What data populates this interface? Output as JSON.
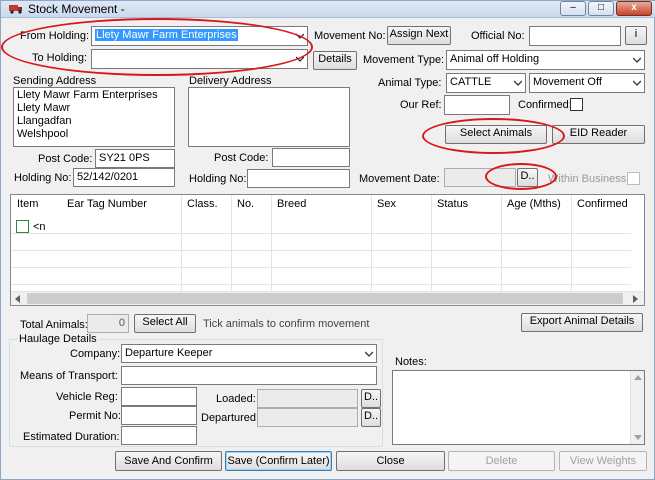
{
  "window": {
    "title": "Stock Movement -",
    "minimize": "–",
    "maximize": "□",
    "close": "x"
  },
  "holdings": {
    "from_label": "From Holding:",
    "from_value": "Llety Mawr Farm Enterprises",
    "to_label": "To Holding:",
    "to_value": "",
    "details_button": "Details"
  },
  "movement": {
    "number_label": "Movement No:",
    "assign_next_button": "Assign Next",
    "official_label": "Official No:",
    "official_value": "",
    "official_button": "i",
    "type_label": "Movement Type:",
    "type_value": "Animal off Holding",
    "animal_type_label": "Animal Type:",
    "animal_type_value": "CATTLE",
    "direction_value": "Movement Off",
    "our_ref_label": "Our Ref:",
    "our_ref_value": "",
    "confirmed_label": "Confirmed:",
    "select_animals_button": "Select Animals",
    "eid_reader_button": "EID Reader",
    "date_label": "Movement Date:",
    "date_value": "",
    "date_button": "D..",
    "within_business_label": "Within Business"
  },
  "sending": {
    "address_label": "Sending Address",
    "address_lines": [
      "Llety Mawr Farm Enterprises",
      "Llety Mawr",
      "Llangadfan",
      "Welshpool"
    ],
    "postcode_label": "Post Code:",
    "postcode_value": "SY21 0PS",
    "holding_no_label": "Holding No:",
    "holding_no_value": "52/142/0201"
  },
  "delivery": {
    "address_label": "Delivery Address",
    "postcode_label": "Post Code:",
    "postcode_value": "",
    "holding_no_label": "Holding No:",
    "holding_no_value": ""
  },
  "grid": {
    "columns": [
      "Item",
      "Ear Tag Number",
      "Class.",
      "No.",
      "Breed",
      "Sex",
      "Status",
      "Age (Mths)",
      "Confirmed"
    ],
    "first_row_item": "<n"
  },
  "totals": {
    "total_animals_label": "Total Animals:",
    "total_animals_value": "0",
    "select_all_button": "Select All",
    "hint": "Tick animals to confirm movement",
    "export_button": "Export Animal Details"
  },
  "haulage": {
    "group_label": "Haulage Details",
    "company_label": "Company:",
    "company_value": "Departure Keeper",
    "transport_label": "Means of Transport:",
    "transport_value": "",
    "vehicle_label": "Vehicle Reg:",
    "vehicle_value": "",
    "permit_label": "Permit No:",
    "permit_value": "",
    "duration_label": "Estimated Duration:",
    "duration_value": "",
    "loaded_label": "Loaded:",
    "loaded_value": "",
    "loaded_button": "D..",
    "departured_label": "Departured:",
    "departured_value": "",
    "departured_button": "D.."
  },
  "notes": {
    "label": "Notes:",
    "value": ""
  },
  "footer": {
    "save_confirm": "Save And Confirm",
    "save_later": "Save (Confirm Later)",
    "close": "Close",
    "delete": "Delete",
    "view_weights": "View Weights"
  },
  "colors": {
    "annotation_red": "#d9161c",
    "selection_blue": "#3399ff",
    "window_bg": "#f0f0f0"
  }
}
